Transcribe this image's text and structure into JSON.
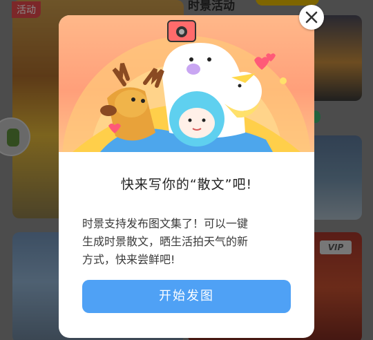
{
  "background": {
    "activity_tag": "活动",
    "header_text": "时景活动",
    "vip_badge": "VIP"
  },
  "modal": {
    "title": "快来写你的“散文”吧!",
    "body_lines": [
      "时景支持发布图文集了！可以一键",
      "生成时景散文，晒生活拍天气的新",
      "方式，快来尝鲜吧!"
    ],
    "cta_label": "开始发图",
    "close_icon": "close-icon"
  },
  "colors": {
    "cta": "#4fa1f5",
    "hero_gradient_top": "#ffb889",
    "activity_tag": "#e2474b"
  }
}
